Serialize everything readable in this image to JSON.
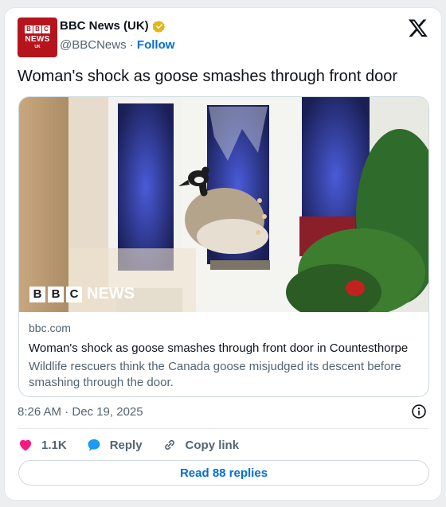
{
  "account": {
    "avatar_blocks": [
      "B",
      "B",
      "C"
    ],
    "avatar_word": "NEWS",
    "avatar_region": "UK",
    "display_name": "BBC News (UK)",
    "handle": "@BBCNews",
    "separator": "·",
    "follow_label": "Follow",
    "verified_icon": "gold-verified-badge"
  },
  "tweet": {
    "text": "Woman's shock as goose smashes through front door",
    "timestamp": "8:26 AM · Dec 19, 2025"
  },
  "link_card": {
    "image_alt": "Canada goose stuck in broken glass of a front door",
    "watermark_blocks": [
      "B",
      "B",
      "C"
    ],
    "watermark_word": "NEWS",
    "domain": "bbc.com",
    "title": "Woman's shock as goose smashes through front door in Countesthorpe",
    "description": "Wildlife rescuers think the Canada goose misjudged its descent before smashing through the door."
  },
  "actions": {
    "like_count": "1.1K",
    "reply_label": "Reply",
    "copy_label": "Copy link"
  },
  "read_replies_label": "Read 88 replies",
  "colors": {
    "link_blue": "#006fd6",
    "like_pink": "#f91880",
    "reply_blue": "#1d9bf0",
    "bbc_red": "#b6141d"
  }
}
